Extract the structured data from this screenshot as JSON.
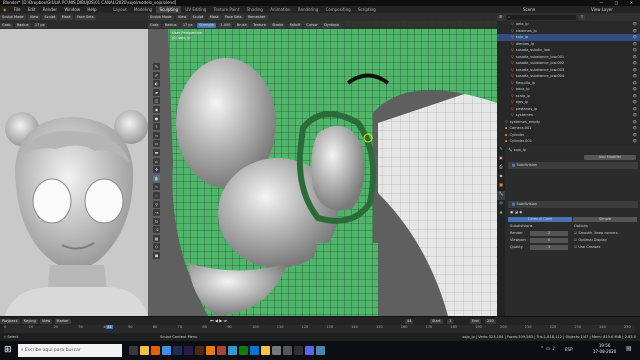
{
  "window": {
    "title": "Blender* [D:\\Dropbox\\GIULIA PC\\MIS DIBUJOS\\01 CANAL\\2020\\sojo\\modelo_sojo.blend]",
    "controls": "— ▢ ✕"
  },
  "menubar": {
    "items": [
      "File",
      "Edit",
      "Render",
      "Window",
      "Help"
    ],
    "workspaces": [
      "Layout",
      "Modeling",
      "Sculpting",
      "UV Editing",
      "Texture Paint",
      "Shading",
      "Animation",
      "Rendering",
      "Compositing",
      "Scripting"
    ],
    "active_workspace": "Sculpting",
    "scene": "Scene",
    "view_layer": "View Layer"
  },
  "left_view": {
    "mode": "Sculpt Mode",
    "menu": [
      "View",
      "Sculpt",
      "Mask",
      "Face Sets"
    ],
    "tool": "Grab",
    "radius_label": "Radius",
    "radius": "17 px"
  },
  "main_view": {
    "mode": "Sculpt Mode",
    "menu": [
      "View",
      "Sculpt",
      "Mask",
      "Face Sets"
    ],
    "remesher": "Remesher",
    "tool": "Grab",
    "radius_label": "Radius",
    "radius": "17 px",
    "strength_label": "Strength",
    "strength": "1.000",
    "extra": [
      "Brush",
      "Texture",
      "Stroke",
      "Falloff",
      "Cursor",
      "Dyntopo"
    ],
    "overlay_line1": "User Perspective",
    "overlay_line2": "(0) sojo_lp"
  },
  "toolbar_icons": [
    "draw-icon",
    "draw-sharp-icon",
    "clay-icon",
    "clay-strips-icon",
    "layer-icon",
    "inflate-icon",
    "blob-icon",
    "crease-icon",
    "smooth-icon",
    "flatten-icon",
    "fill-icon",
    "scrape-icon",
    "pinch-icon",
    "grab-icon",
    "snake-hook-icon",
    "thumb-icon",
    "pose-icon",
    "nudge-icon",
    "rotate-icon",
    "slide-relax-icon",
    "cloth-icon",
    "simplify-icon",
    "mask-icon",
    "box-mask-icon",
    "lasso-mask-icon",
    "annotate-icon",
    "transform-icon"
  ],
  "outliner": {
    "rows": [
      "pelo_lp",
      "sistemas_lp",
      "sojo_lp",
      "dientes_lp",
      "sosada_subdiv_low",
      "sosada_substance_low.001",
      "sosada_substance_low.002",
      "sosada_substance_low.003",
      "sosada_substance_low.004",
      "flequillo_lp",
      "boca_lp",
      "scalp_lp",
      "ojos_lp",
      "pestanas_lp",
      "systemes",
      "systemes_empty",
      "Camera.001",
      "Cylinder",
      "Cylinder.001",
      "Cylinder.002",
      "Cylinder.003"
    ]
  },
  "properties": {
    "object_name": "sojo_lp",
    "add_modifier": "Add Modifier",
    "modifier1": "Subdivision",
    "modifier2": "Subdivision",
    "tabs": [
      "Catmull-Clark",
      "Simple"
    ],
    "subdivisions_label": "Subdivisions",
    "options_label": "Options",
    "rows": [
      {
        "label": "Render",
        "value": "2"
      },
      {
        "label": "Viewport",
        "value": "0"
      },
      {
        "label": "Quality",
        "value": "3"
      }
    ],
    "options": [
      "Smooth, keep corners",
      "Optimal Display",
      "Use Creases"
    ]
  },
  "timeline": {
    "menu": [
      "Playback",
      "Keying",
      "View",
      "Marker"
    ],
    "current_frame": "44",
    "start_label": "Start",
    "start": "1",
    "end_label": "End",
    "end": "250",
    "ticks": [
      "0",
      "10",
      "20",
      "30",
      "40",
      "50",
      "60",
      "70",
      "80",
      "90",
      "100",
      "110",
      "120",
      "130",
      "140",
      "150",
      "160",
      "170",
      "180",
      "190",
      "200",
      "210",
      "220",
      "230",
      "240",
      "250"
    ]
  },
  "statusbar": {
    "left": "Select",
    "middle": "Sculpt Context Menu",
    "right": "sojo_lp | Verts:323,184 | Faces:309,583 | Tris:1,818,112 | Objects:1/47 | Mem: 810.6 MiB | 2.83.0"
  },
  "taskbar": {
    "search": "Escribe aquí para buscar",
    "time": "19:56",
    "date": "17-08-2020",
    "lang": "ESP",
    "app_icons": [
      "task-view-icon",
      "files-icon",
      "firefox-icon",
      "chrome-icon",
      "photoshop-icon",
      "premiere-icon",
      "illustrator-icon",
      "blender-icon",
      "substance-icon",
      "media-icon",
      "xbox-icon",
      "mail-icon",
      "folder-icon",
      "settings-icon",
      "winamp-icon",
      "obs-icon",
      "discord-icon",
      "paint-icon"
    ],
    "app_colors": [
      "#3a3a3a",
      "#f0c040",
      "#e66000",
      "#3c8ee8",
      "#1c2d5a",
      "#2a1a4a",
      "#4a2a0a",
      "#e87d0d",
      "#a43",
      "#39c",
      "#107c10",
      "#0078d4",
      "#f5c542",
      "#777",
      "#555",
      "#302e31",
      "#5865f2",
      "#48a"
    ]
  }
}
